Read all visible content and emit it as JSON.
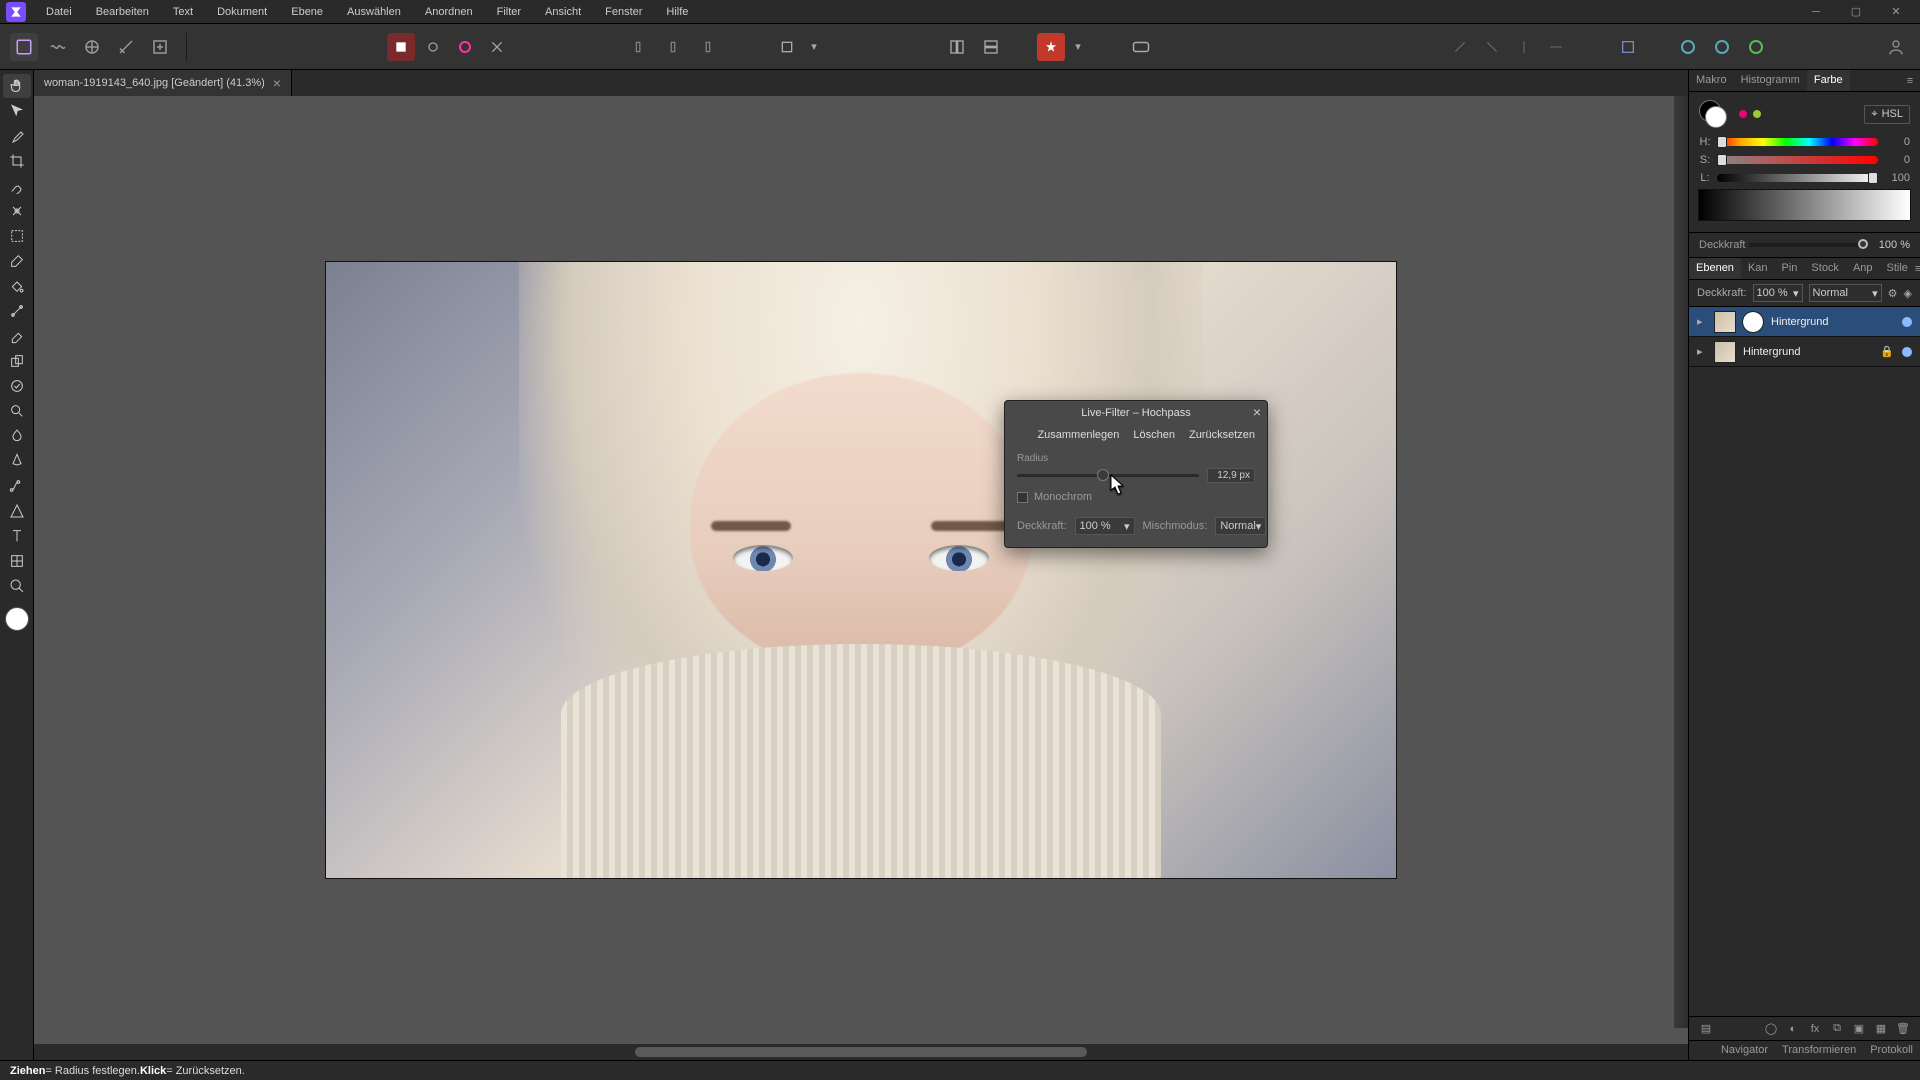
{
  "menu": {
    "items": [
      "Datei",
      "Bearbeiten",
      "Text",
      "Dokument",
      "Ebene",
      "Auswählen",
      "Anordnen",
      "Filter",
      "Ansicht",
      "Fenster",
      "Hilfe"
    ]
  },
  "document": {
    "tab_title": "woman-1919143_640.jpg [Geändert] (41.3%)"
  },
  "dialog": {
    "title": "Live-Filter – Hochpass",
    "actions": {
      "merge": "Zusammenlegen",
      "delete": "Löschen",
      "reset": "Zurücksetzen"
    },
    "radius_label": "Radius",
    "radius_value": "12,9 px",
    "mono_label": "Monochrom",
    "opacity_label": "Deckkraft:",
    "opacity_value": "100 %",
    "blend_label": "Mischmodus:",
    "blend_value": "Normal"
  },
  "color_tabs": {
    "makro": "Makro",
    "histogram": "Histogramm",
    "farbe": "Farbe"
  },
  "color_panel": {
    "mode": "HSL",
    "h": {
      "label": "H:",
      "value": "0"
    },
    "s": {
      "label": "S:",
      "value": "0"
    },
    "l": {
      "label": "L:",
      "value": "100"
    },
    "opacity_label": "Deckkraft",
    "opacity_value": "100 %"
  },
  "layer_tabs": [
    "Ebenen",
    "Kan",
    "Pin",
    "Stock",
    "Anp",
    "Stile"
  ],
  "layer_strip": {
    "opacity_label": "Deckkraft:",
    "opacity_value": "100 %",
    "blend_value": "Normal"
  },
  "layers": [
    {
      "name": "Hintergrund",
      "selected": true,
      "has_mask": true
    },
    {
      "name": "Hintergrund",
      "selected": false,
      "has_mask": false
    }
  ],
  "bottom_tabs": [
    "Navigator",
    "Transformieren",
    "Protokoll"
  ],
  "status": {
    "drag": "Ziehen",
    "drag_desc": " = Radius festlegen.  ",
    "click": "Klick",
    "click_desc": " = Zurücksetzen."
  }
}
